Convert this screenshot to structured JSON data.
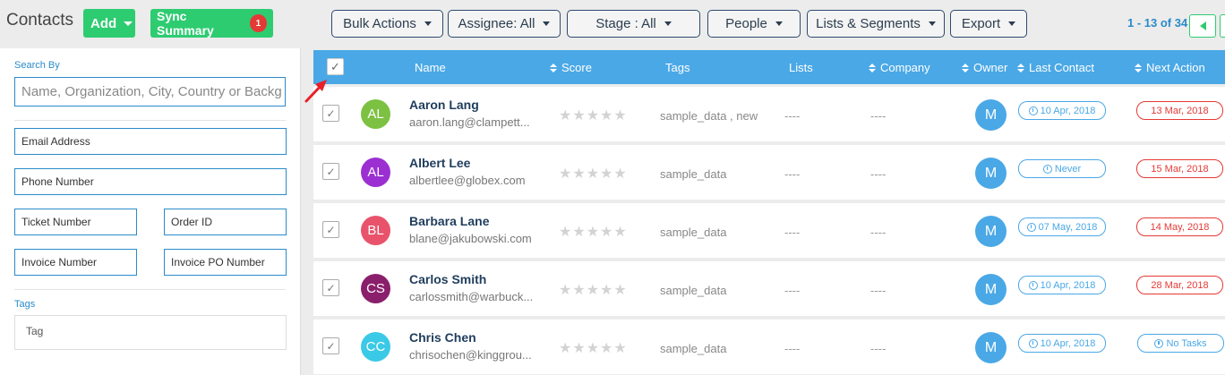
{
  "header": {
    "title": "Contacts",
    "add_label": "Add",
    "sync_label": "Sync Summary",
    "sync_count": "1",
    "filters": [
      {
        "label": "Bulk Actions"
      },
      {
        "label": "Assignee: All"
      },
      {
        "label": "Stage : All"
      },
      {
        "label": "People"
      },
      {
        "label": "Lists & Segments"
      },
      {
        "label": "Export"
      }
    ],
    "pagination": "1 - 13 of 34"
  },
  "sidebar": {
    "search_by_label": "Search By",
    "search_placeholder": "Name, Organization, City, Country or Backg",
    "email": "Email Address",
    "phone": "Phone Number",
    "ticket": "Ticket Number",
    "order": "Order ID",
    "invoice": "Invoice Number",
    "invoice_po": "Invoice PO Number",
    "tags_label": "Tags",
    "tag_placeholder": "Tag"
  },
  "table": {
    "columns": {
      "name": "Name",
      "score": "Score",
      "tags": "Tags",
      "lists": "Lists",
      "company": "Company",
      "owner": "Owner",
      "last_contact": "Last Contact",
      "next_action": "Next Action"
    },
    "check_glyph": "✓",
    "rows": [
      {
        "initials": "AL",
        "color": "#7cc142",
        "name": "Aaron Lang",
        "email": "aaron.lang@clampett...",
        "tags": "sample_data , new",
        "lists": "----",
        "company": "----",
        "owner": "M",
        "last_contact": "10 Apr, 2018",
        "next_action": "13 Mar, 2018"
      },
      {
        "initials": "AL",
        "color": "#9b2fd1",
        "name": "Albert Lee",
        "email": "albertlee@globex.com",
        "tags": "sample_data",
        "lists": "----",
        "company": "----",
        "owner": "M",
        "last_contact": "Never",
        "next_action": "15 Mar, 2018"
      },
      {
        "initials": "BL",
        "color": "#e8536b",
        "name": "Barbara Lane",
        "email": "blane@jakubowski.com",
        "tags": "sample_data",
        "lists": "----",
        "company": "----",
        "owner": "M",
        "last_contact": "07 May, 2018",
        "next_action": "14 May, 2018"
      },
      {
        "initials": "CS",
        "color": "#8a1f6b",
        "name": "Carlos Smith",
        "email": "carlossmith@warbuck...",
        "tags": "sample_data",
        "lists": "----",
        "company": "----",
        "owner": "M",
        "last_contact": "10 Apr, 2018",
        "next_action": "28 Mar, 2018"
      },
      {
        "initials": "CC",
        "color": "#3ac9e6",
        "name": "Chris Chen",
        "email": "chrisochen@kinggrou...",
        "tags": "sample_data",
        "lists": "----",
        "company": "----",
        "owner": "M",
        "last_contact": "10 Apr, 2018",
        "next_action": "No Tasks"
      }
    ]
  },
  "colors": {
    "accent": "#4aa8e6",
    "green": "#2ecc71",
    "danger": "#e53935",
    "navy": "#1f3d5c"
  }
}
